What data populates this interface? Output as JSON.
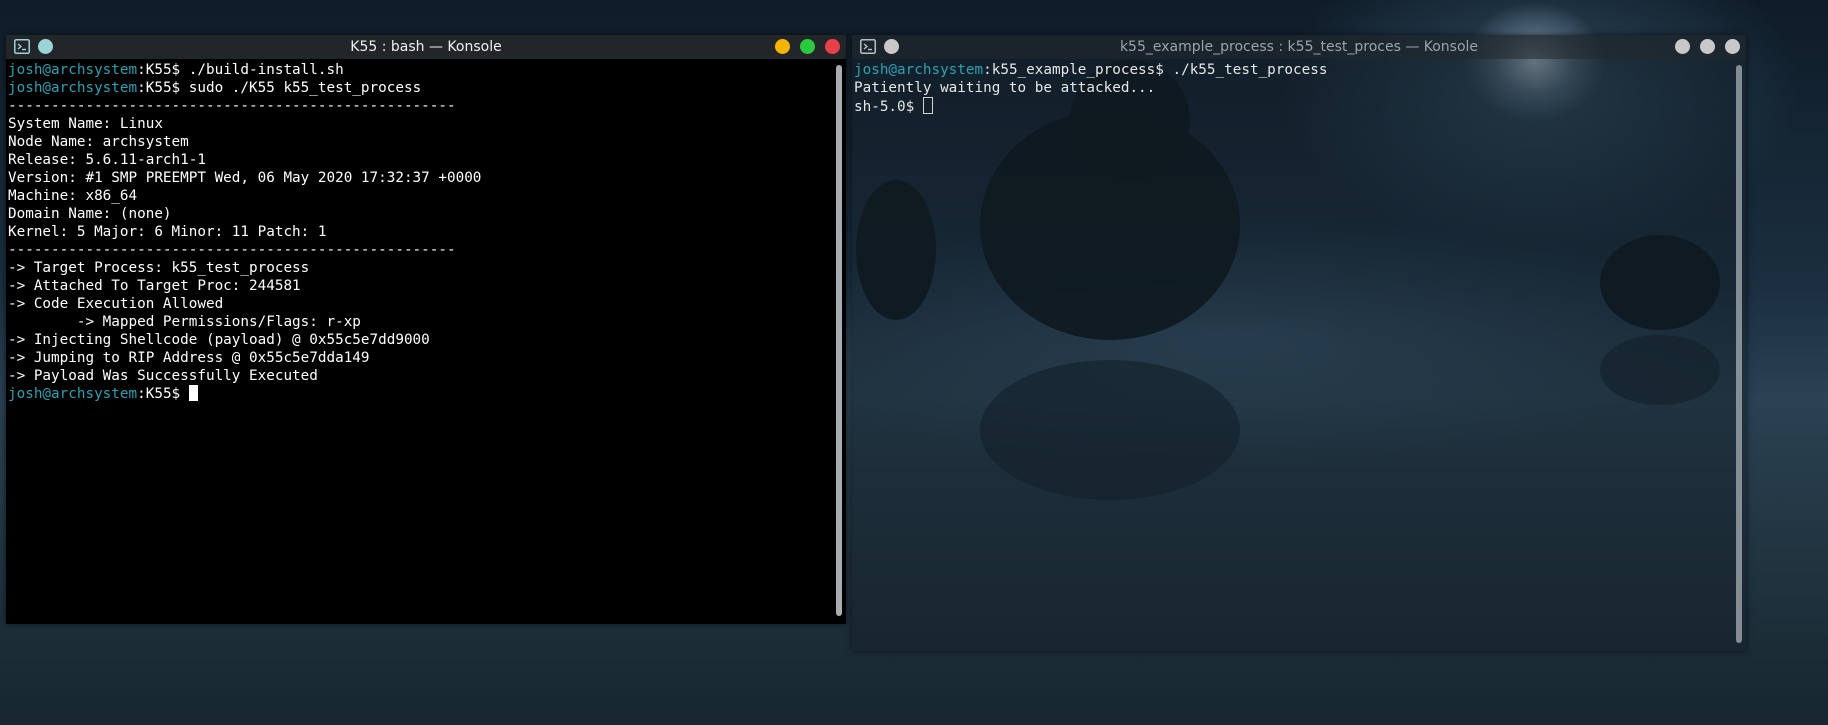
{
  "colors": {
    "prompt_user": "#2aa1b3",
    "minimize_dot": "#f4b400",
    "maximize_dot": "#2bc93f",
    "close_dot": "#e9414a",
    "pin_dot": "#9bd3d6",
    "inactive_dot": "#c8c8c8"
  },
  "window1": {
    "title": "K55 : bash — Konsole",
    "lines": [
      {
        "user": "josh@archsystem",
        "rest": ":K55$ ./build-install.sh"
      },
      {
        "user": "josh@archsystem",
        "rest": ":K55$ sudo ./K55 k55_test_process"
      },
      {
        "text": "----------------------------------------------------"
      },
      {
        "text": "System Name: Linux"
      },
      {
        "text": "Node Name: archsystem"
      },
      {
        "text": "Release: 5.6.11-arch1-1"
      },
      {
        "text": "Version: #1 SMP PREEMPT Wed, 06 May 2020 17:32:37 +0000"
      },
      {
        "text": "Machine: x86_64"
      },
      {
        "text": "Domain Name: (none)"
      },
      {
        "text": "Kernel: 5 Major: 6 Minor: 11 Patch: 1"
      },
      {
        "text": "----------------------------------------------------"
      },
      {
        "text": "-> Target Process: k55_test_process"
      },
      {
        "text": "-> Attached To Target Proc: 244581"
      },
      {
        "text": "-> Code Execution Allowed"
      },
      {
        "text": "        -> Mapped Permissions/Flags: r-xp"
      },
      {
        "text": "-> Injecting Shellcode (payload) @ 0x55c5e7dd9000"
      },
      {
        "text": "-> Jumping to RIP Address @ 0x55c5e7dda149"
      },
      {
        "text": "-> Payload Was Successfully Executed"
      },
      {
        "user": "josh@archsystem",
        "rest": ":K55$ ",
        "cursor": "block"
      }
    ],
    "buttons": {
      "minimize_icon": "minimize-icon",
      "maximize_icon": "maximize-icon",
      "close_icon": "close-icon"
    }
  },
  "window2": {
    "title": "k55_example_process : k55_test_proces — Konsole",
    "lines": [
      {
        "user": "josh@archsystem",
        "rest": ":k55_example_process$ ./k55_test_process"
      },
      {
        "text": "Patiently waiting to be attacked..."
      },
      {
        "text": "sh-5.0$ ",
        "cursor": "hollow"
      }
    ]
  }
}
